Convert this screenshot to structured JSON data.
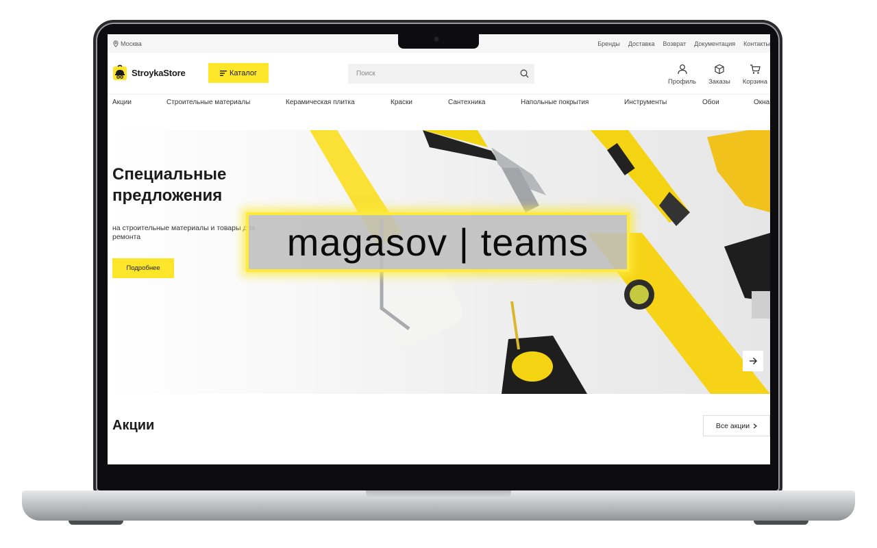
{
  "topbar": {
    "city": "Москва",
    "links": [
      "Бренды",
      "Доставка",
      "Возврат",
      "Документация",
      "Контакты"
    ]
  },
  "header": {
    "logo_text": "StroykaStore",
    "catalog_label": "Каталог",
    "search_placeholder": "Поиск",
    "nav": [
      {
        "label": "Профиль",
        "icon": "user-icon"
      },
      {
        "label": "Заказы",
        "icon": "box-icon"
      },
      {
        "label": "Корзина",
        "icon": "cart-icon"
      }
    ]
  },
  "categories": [
    "Акции",
    "Строительные материалы",
    "Керамическая плитка",
    "Краски",
    "Сантехника",
    "Напольные покрытия",
    "Инструменты",
    "Обои",
    "Окна"
  ],
  "hero": {
    "title": "Специальные предложения",
    "subtitle": "на строительные материалы и товары для ремонта",
    "button_label": "Подробнее"
  },
  "watermark": "magasov | teams",
  "promos": {
    "title": "Акции",
    "all_label": "Все акции"
  },
  "colors": {
    "accent": "#fde629",
    "text": "#1b1b1b",
    "muted": "#555555"
  }
}
